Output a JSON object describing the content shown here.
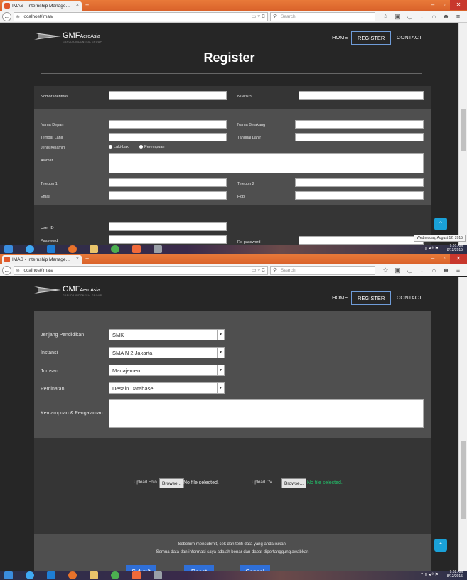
{
  "browser": {
    "tab_title": "IMAS - Internship Manage...",
    "tab_close": "×",
    "new_tab": "+",
    "url": "localhost/imas/",
    "search_placeholder": "Search"
  },
  "site": {
    "logo_text": "GMF",
    "logo_suffix": "AeroAsia",
    "logo_sub": "GARUDA INDONESIA GROUP",
    "nav": [
      "HOME",
      "REGISTER",
      "CONTACT"
    ],
    "active_nav": "REGISTER"
  },
  "shot1": {
    "title": "Register",
    "fields": {
      "nomor_identitas": "Nomor Identitas",
      "nim_nis": "NIM/NIS",
      "nama_depan": "Nama Depan",
      "nama_belakang": "Nama Belakang",
      "tempat_lahir": "Tempat Lahir",
      "tanggal_lahir": "Tanggal Lahir",
      "jenis_kelamin": "Jenis Kelamin",
      "gender_options": [
        "Laki-Laki",
        "Perempuan"
      ],
      "alamat": "Alamat",
      "telepon1": "Telepon 1",
      "telepon2": "Telepon 2",
      "email": "Email",
      "hobi": "Hobi",
      "user_id": "User ID",
      "password": "Password",
      "re_password": "Re-password"
    },
    "taskbar_tooltip": "Wednesday, August 12, 2015",
    "clock_time": "9:01 AM",
    "clock_date": "8/12/2015"
  },
  "shot2": {
    "fields": {
      "jenjang_label": "Jenjang Pendidikan",
      "jenjang_value": "SMK",
      "instansi_label": "Instansi",
      "instansi_value": "SMA N 2 Jakarta",
      "jurusan_label": "Jurusan",
      "jurusan_value": "Manajemen",
      "peminatan_label": "Peminatan",
      "peminatan_value": "Desain Database",
      "kemampuan_label": "Kemampuan & Pengalaman"
    },
    "upload": {
      "foto_label": "Upload Foto",
      "cv_label": "Upload CV",
      "browse": "Browse...",
      "no_file": "No file selected."
    },
    "note_line1": "Sebelum mensubmit, cek dan teliti data yang anda isikan.",
    "note_line2": "Semua data dan informasi saya adalah benar dan dapat dipertanggungjawabkan",
    "buttons": {
      "submit": "Submit",
      "reset": "Reset",
      "cancel": "Cancel"
    },
    "clock_time": "9:02 AM",
    "clock_date": "8/12/2015"
  },
  "icons": [
    "back-arrow-icon",
    "refresh-icon",
    "search-icon",
    "star-icon",
    "clipboard-icon",
    "pocket-icon",
    "download-icon",
    "home-icon",
    "smiley-icon",
    "menu-icon",
    "scroll-top-icon",
    "windows-start-icon",
    "ie-icon",
    "media-icon",
    "firefox-icon",
    "folder-icon",
    "chrome-icon",
    "app-icon",
    "paint-icon"
  ]
}
